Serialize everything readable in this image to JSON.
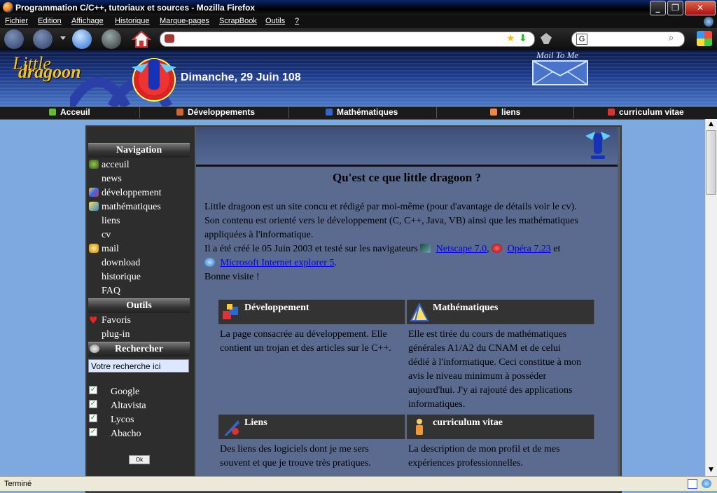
{
  "window": {
    "title": "Programmation C/C++, tutoriaux et sources - Mozilla Firefox",
    "minimize": "_",
    "restore": "❐",
    "close": "✕"
  },
  "menu": [
    "Fichier",
    "Edition",
    "Affichage",
    "Historique",
    "Marque-pages",
    "ScrapBook",
    "Outils",
    "?"
  ],
  "site": {
    "logo_top": "Little",
    "logo_bottom": "dragoon",
    "date": "Dimanche, 29 Juin 108",
    "mail": "Mail To Me"
  },
  "topnav": [
    "Acceuil",
    "Développements",
    "Mathématiques",
    "liens",
    "curriculum vitae"
  ],
  "sidebar": {
    "nav_title": "Navigation",
    "nav_items": [
      "acceuil",
      "news",
      "développement",
      "mathématiques",
      "liens",
      "cv",
      "mail",
      "download",
      "historique",
      "FAQ"
    ],
    "tools_title": "Outils",
    "tools_items": [
      "Favoris",
      "plug-in"
    ],
    "search_title": "Rechercher",
    "search_placeholder": "Votre recherche ici",
    "engines": [
      "Google",
      "Altavista",
      "Lycos",
      "Abacho"
    ],
    "check_mark": "✓",
    "ok": "Ok"
  },
  "main": {
    "title": "Qu'est ce que little dragoon ?",
    "intro_1": "Little dragoon est un site concu et rédigé par moi-même (pour d'avantage de détails voir le cv).",
    "intro_2": "Son contenu est orienté vers le développement (C, C++, Java, VB) ainsi que les mathématiques",
    "intro_3": "appliquées à l'informatique.",
    "intro_4": "Il a été créé le 05 Juin 2003 et testé sur les navigateurs",
    "browser_1": "Netscape 7.0",
    "sep_1": ",",
    "browser_2": "Opéra 7.23",
    "sep_2": "et",
    "browser_3": "Microsoft Internet explorer 5",
    "sep_3": ".",
    "outro": "Bonne visite !",
    "cards": [
      {
        "title": "Développement",
        "lines": [
          "La page consacrée au développement. Elle",
          "contient un trojan et des articles sur le C++."
        ]
      },
      {
        "title": "Mathématiques",
        "lines": [
          "Elle est tirée du cours de mathématiques",
          "générales A1/A2 du CNAM et de celui",
          "dédié à l'informatique. Ceci constitue à mon",
          "avis le niveau minimum à posséder",
          "aujourd'hui. J'y ai rajouté des applications",
          "informatiques."
        ]
      },
      {
        "title": "Liens",
        "lines": [
          "Des liens des logiciels dont je me sers",
          "souvent et que je trouve très pratiques."
        ]
      },
      {
        "title": "curriculum vitae",
        "lines": [
          "La description de mon profil et de mes",
          "expériences professionnelles."
        ]
      }
    ]
  },
  "scroll": {
    "up": "▲",
    "down": "▼"
  },
  "status": {
    "text": "Terminé"
  },
  "colors": {
    "header_blue": "#1d3a8a",
    "link": "#0000ee",
    "sidebar": "#2d2d2d",
    "content": "#5a6b8f"
  }
}
